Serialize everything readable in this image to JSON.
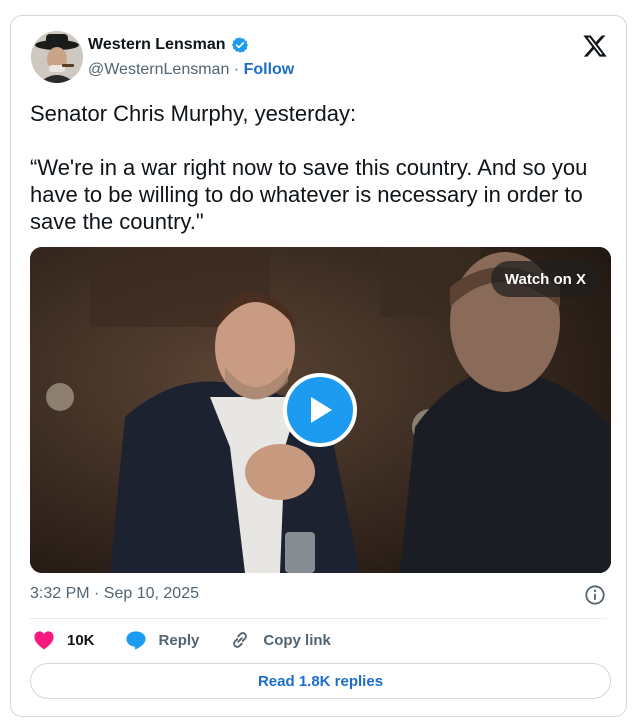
{
  "author": {
    "display_name": "Western Lensman",
    "handle": "@WesternLensman",
    "separator": "·",
    "follow_label": "Follow",
    "verified_icon": "verified-badge-icon"
  },
  "tweet": {
    "line1": "Senator Chris Murphy, yesterday:",
    "quote": "“We're in a war right now to save this country. And so you have to be willing to do whatever is necessary in order to save the country.\""
  },
  "media": {
    "watch_label": "Watch on X",
    "play_icon": "play-icon"
  },
  "meta": {
    "timestamp": "3:32 PM · Sep 10, 2025",
    "info_icon": "info-icon"
  },
  "actions": {
    "like_count": "10K",
    "reply_label": "Reply",
    "copy_label": "Copy link"
  },
  "read_replies_label": "Read 1.8K replies",
  "colors": {
    "accent": "#1d9bf0",
    "link": "#1d6ec9",
    "like": "#f91880",
    "muted": "#536471",
    "border": "#cfd9de"
  }
}
